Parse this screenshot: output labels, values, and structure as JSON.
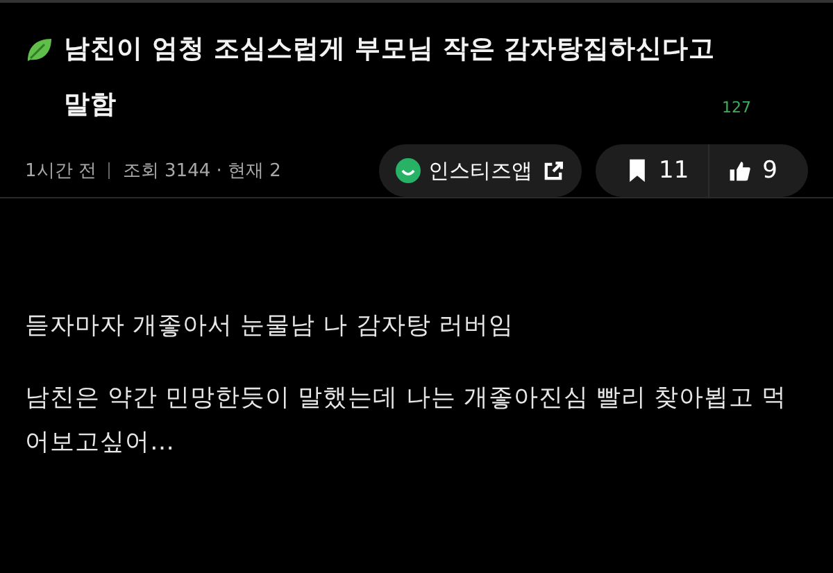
{
  "post": {
    "title": "남친이 엄청 조심스럽게 부모님 작은 감자탕집하신다고 말함",
    "comment_count": "127",
    "time": "1시간 전",
    "views": "조회 3144 · 현재 2",
    "app_button": "인스티즈앱",
    "bookmarks": "11",
    "likes": "9"
  },
  "body": [
    "듣자마자 개좋아서 눈물남 나 감자탕 러버임",
    "남친은 약간 민망한듯이 말했는데 나는 개좋아진심 빨리 찾아뵙고 먹어보고싶어…"
  ]
}
